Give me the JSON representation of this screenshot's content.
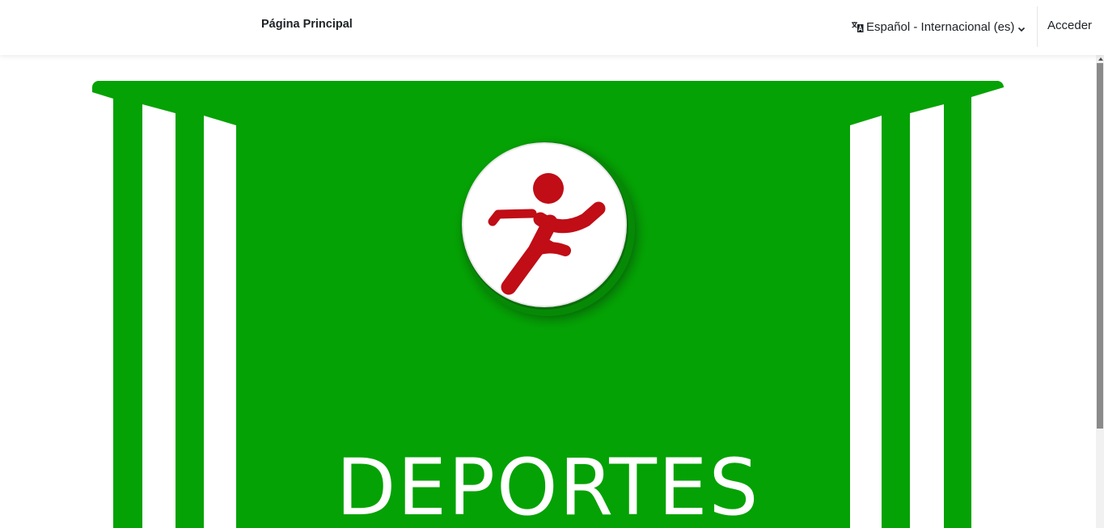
{
  "navbar": {
    "home_label": "Página Principal",
    "language": {
      "icon": "language-icon",
      "label": "Español - Internacional (es)",
      "dropdown_icon": "chevron-down-icon"
    },
    "login_label": "Acceder"
  },
  "hero": {
    "title": "DEPORTES",
    "logo": "running-figure-icon",
    "colors": {
      "background": "#04a204",
      "stripes": "#ffffff",
      "figure": "#c00d16"
    }
  }
}
